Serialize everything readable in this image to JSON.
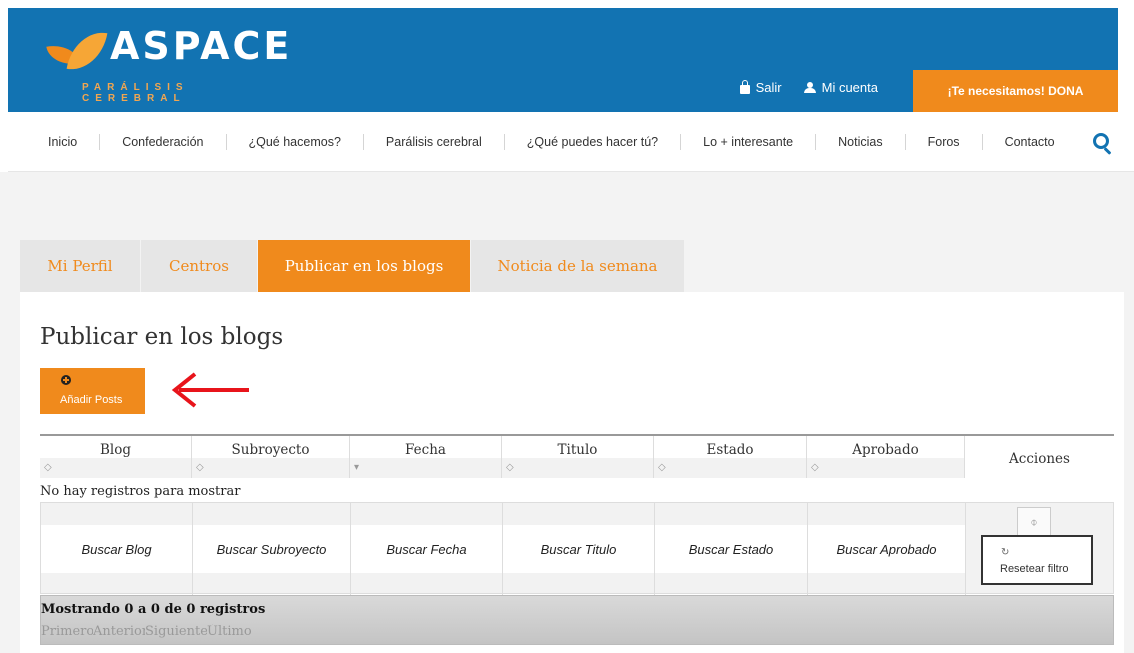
{
  "brand": {
    "name": "ASPACE",
    "tagline": "PARÁLISIS CEREBRAL"
  },
  "header": {
    "logout_label": "Salir",
    "account_label": "Mi cuenta",
    "donate_label": "¡Te necesitamos! DONA"
  },
  "nav": {
    "items": [
      {
        "label": "Inicio"
      },
      {
        "label": "Confederación"
      },
      {
        "label": "¿Qué hacemos?"
      },
      {
        "label": "Parálisis cerebral"
      },
      {
        "label": "¿Qué puedes hacer tú?"
      },
      {
        "label": "Lo + interesante"
      },
      {
        "label": "Noticias"
      },
      {
        "label": "Foros"
      },
      {
        "label": "Contacto"
      }
    ]
  },
  "tabs": [
    {
      "label": "Mi Perfil",
      "active": false
    },
    {
      "label": "Centros",
      "active": false
    },
    {
      "label": "Publicar en los blogs",
      "active": true
    },
    {
      "label": "Noticia de la semana",
      "active": false
    }
  ],
  "main": {
    "title": "Publicar en los blogs",
    "add_button_label": "Añadir Posts"
  },
  "table": {
    "columns": [
      "Blog",
      "Subroyecto",
      "Fecha",
      "Titulo",
      "Estado",
      "Aprobado",
      "Acciones"
    ],
    "empty_message": "No hay registros para mostrar",
    "filters": [
      "Buscar Blog",
      "Buscar Subroyecto",
      "Buscar Fecha",
      "Buscar Titulo",
      "Buscar Estado",
      "Buscar Aprobado"
    ],
    "reset_label": "Resetear filtro",
    "records_info": "Mostrando 0 a 0 de 0 registros",
    "pager": [
      "Primero",
      "Anterior",
      "Siguiente",
      "Último"
    ]
  },
  "colors": {
    "header_blue": "#1273b2",
    "accent_orange": "#f08a1c"
  }
}
